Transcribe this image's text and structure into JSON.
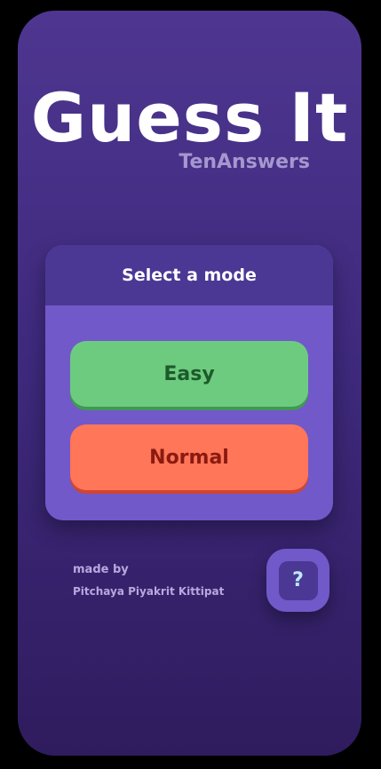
{
  "app": {
    "title": "Guess It",
    "subtitle": "TenAnswers"
  },
  "mode_select": {
    "heading": "Select a mode",
    "options": [
      {
        "label": "Easy",
        "color": "#6dcb7f",
        "text_color": "#1d5a2b"
      },
      {
        "label": "Normal",
        "color": "#ff7659",
        "text_color": "#8a1a10"
      }
    ]
  },
  "credits": {
    "made_by_label": "made by",
    "authors": "Pitchaya Piyakrit Kittipat"
  },
  "help_button": {
    "glyph": "?",
    "icon": "question-mark-icon"
  },
  "colors": {
    "background_top": "#4e3690",
    "background_bottom": "#2f1c5e",
    "card": "#7159c9",
    "card_header": "#4b3894",
    "subtitle": "#a597cf"
  }
}
